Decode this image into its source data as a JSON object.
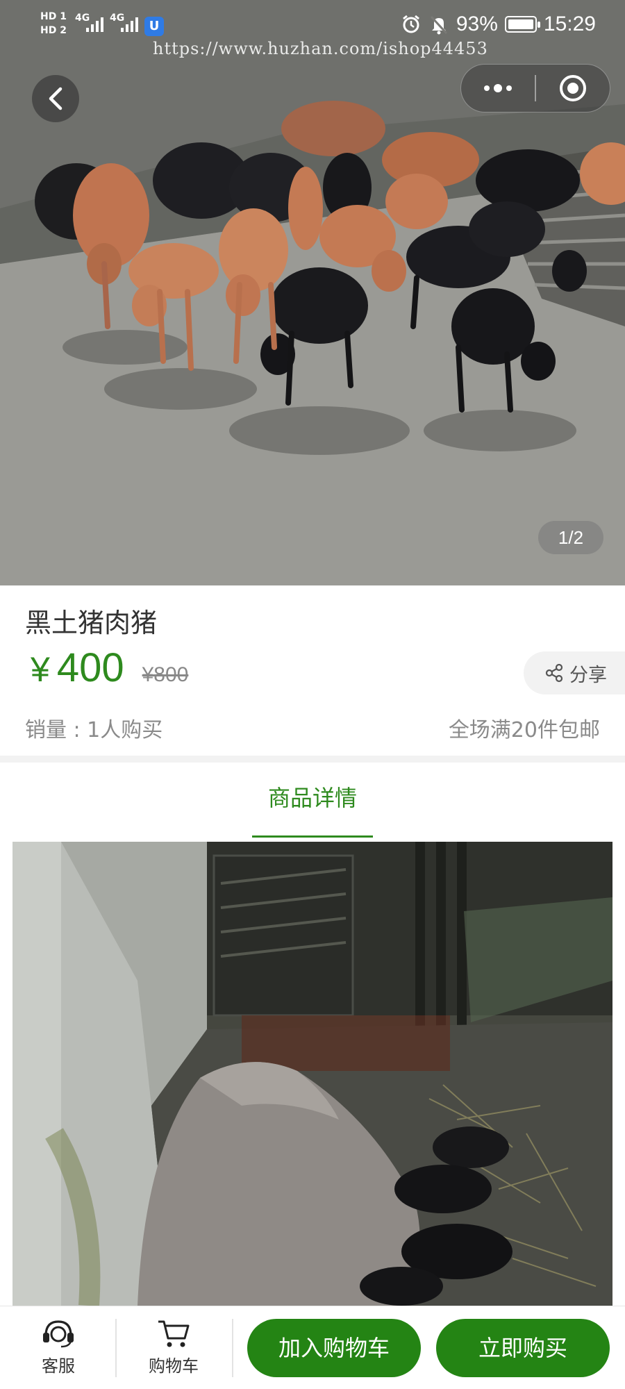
{
  "status_bar": {
    "hd1": "HD 1",
    "hd2": "HD 2",
    "net1": "4G",
    "net2": "4G",
    "app_icon": "U",
    "battery": "93%",
    "time": "15:29"
  },
  "watermark": "https://www.huzhan.com/ishop44453",
  "nav": {
    "back_icon": "chevron-left-icon",
    "menu_icon": "more-dots-icon",
    "close_icon": "target-icon"
  },
  "gallery": {
    "pager": "1/2"
  },
  "product": {
    "title": "黑土猪肉猪",
    "currency": "¥",
    "price": "400",
    "original_price": "¥800",
    "share_label": "分享",
    "sales": "销量 : 1人购买",
    "shipping": "全场满20件包邮"
  },
  "tabs": {
    "detail": "商品详情"
  },
  "bottom_bar": {
    "service_label": "客服",
    "cart_label": "购物车",
    "add_to_cart": "加入购物车",
    "buy_now": "立即购买"
  },
  "colors": {
    "accent": "#2e8a1e",
    "button": "#248414"
  }
}
